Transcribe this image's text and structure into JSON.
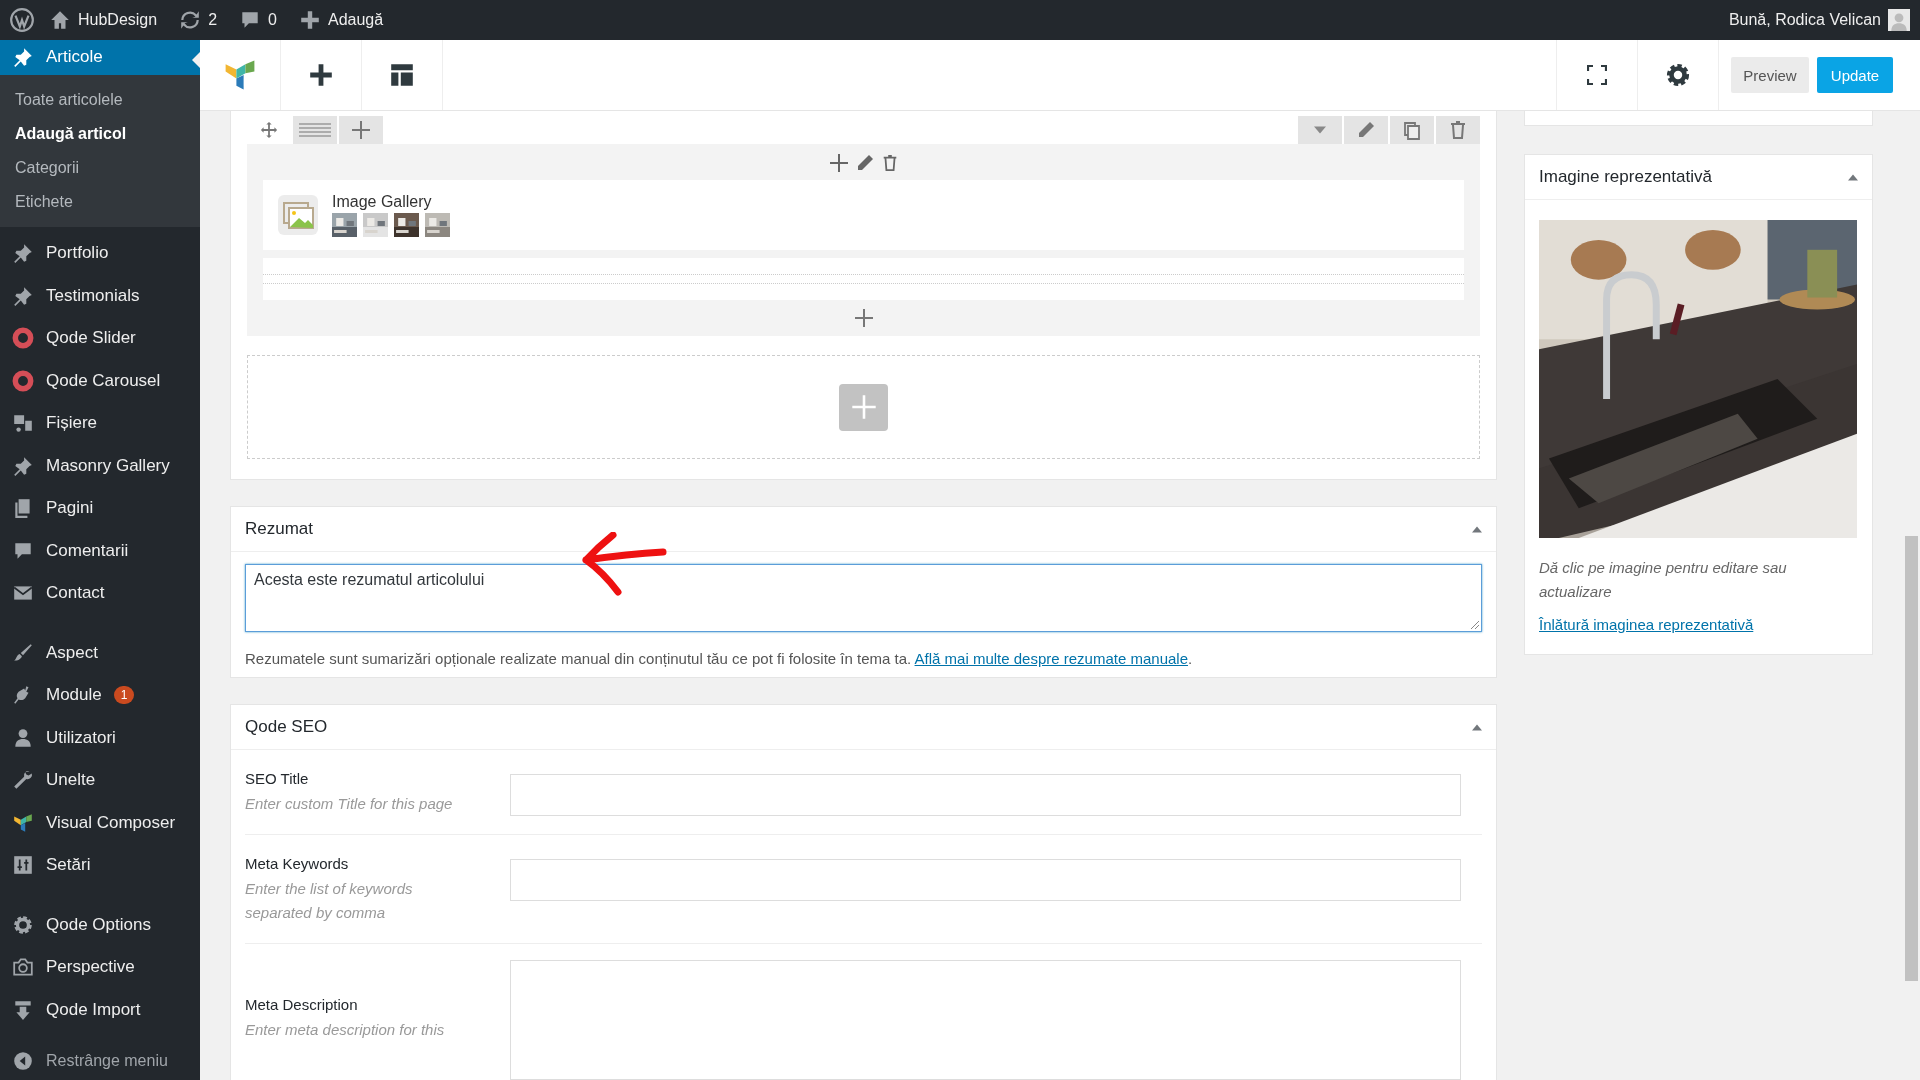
{
  "admin_bar": {
    "site": "HubDesign",
    "updates": "2",
    "comments": "0",
    "new": "Adaugă",
    "greeting": "Bună, Rodica Velican"
  },
  "sidebar": {
    "current": {
      "label": "Articole",
      "selected": true,
      "submenu": [
        {
          "label": "Toate articolele",
          "selected": false
        },
        {
          "label": "Adaugă articol",
          "selected": true
        },
        {
          "label": "Categorii",
          "selected": false
        },
        {
          "label": "Etichete",
          "selected": false
        }
      ]
    },
    "groups": [
      [
        {
          "label": "Portfolio",
          "selected": false
        },
        {
          "label": "Testimonials",
          "selected": false
        },
        {
          "label": "Qode Slider",
          "selected": false
        },
        {
          "label": "Qode Carousel",
          "selected": false
        },
        {
          "label": "Fișiere",
          "selected": false
        },
        {
          "label": "Masonry Gallery",
          "selected": false
        },
        {
          "label": "Pagini",
          "selected": false
        },
        {
          "label": "Comentarii",
          "selected": false
        },
        {
          "label": "Contact",
          "selected": false
        }
      ],
      [
        {
          "label": "Aspect",
          "selected": false
        },
        {
          "label": "Module",
          "badge": "1",
          "selected": false
        },
        {
          "label": "Utilizatori",
          "selected": false
        },
        {
          "label": "Unelte",
          "selected": false
        },
        {
          "label": "Visual Composer",
          "selected": false
        },
        {
          "label": "Setări",
          "selected": false
        }
      ],
      [
        {
          "label": "Qode Options",
          "selected": false
        },
        {
          "label": "Perspective",
          "selected": false
        },
        {
          "label": "Qode Import",
          "selected": false
        }
      ]
    ],
    "collapse": "Restrânge meniu"
  },
  "composer": {
    "buttons": [
      "Preview",
      "Update"
    ],
    "element": {
      "title": "Image Gallery"
    }
  },
  "excerpt": {
    "title": "Rezumat",
    "value": "Acesta este rezumatul articolului",
    "help": "Rezumatele sunt sumarizări opționale realizate manual din conținutul tău ce pot fi folosite în tema ta.",
    "link": "Află mai multe despre rezumate manuale",
    "after_link": "."
  },
  "seo": {
    "title": "Qode SEO",
    "fields": [
      {
        "kind": "input",
        "label": "SEO Title",
        "hint": "Enter custom Title for this page"
      },
      {
        "kind": "input",
        "label": "Meta Keywords",
        "hint": "Enter the list of keywords separated by comma"
      },
      {
        "kind": "textarea",
        "label": "Meta Description",
        "hint": "Enter meta description for this"
      }
    ]
  },
  "featured_image": {
    "title": "Imagine reprezentativă",
    "hint": "Dă clic pe imagine pentru editare sau actualizare",
    "link": "Înlătură imaginea reprezentativă"
  }
}
